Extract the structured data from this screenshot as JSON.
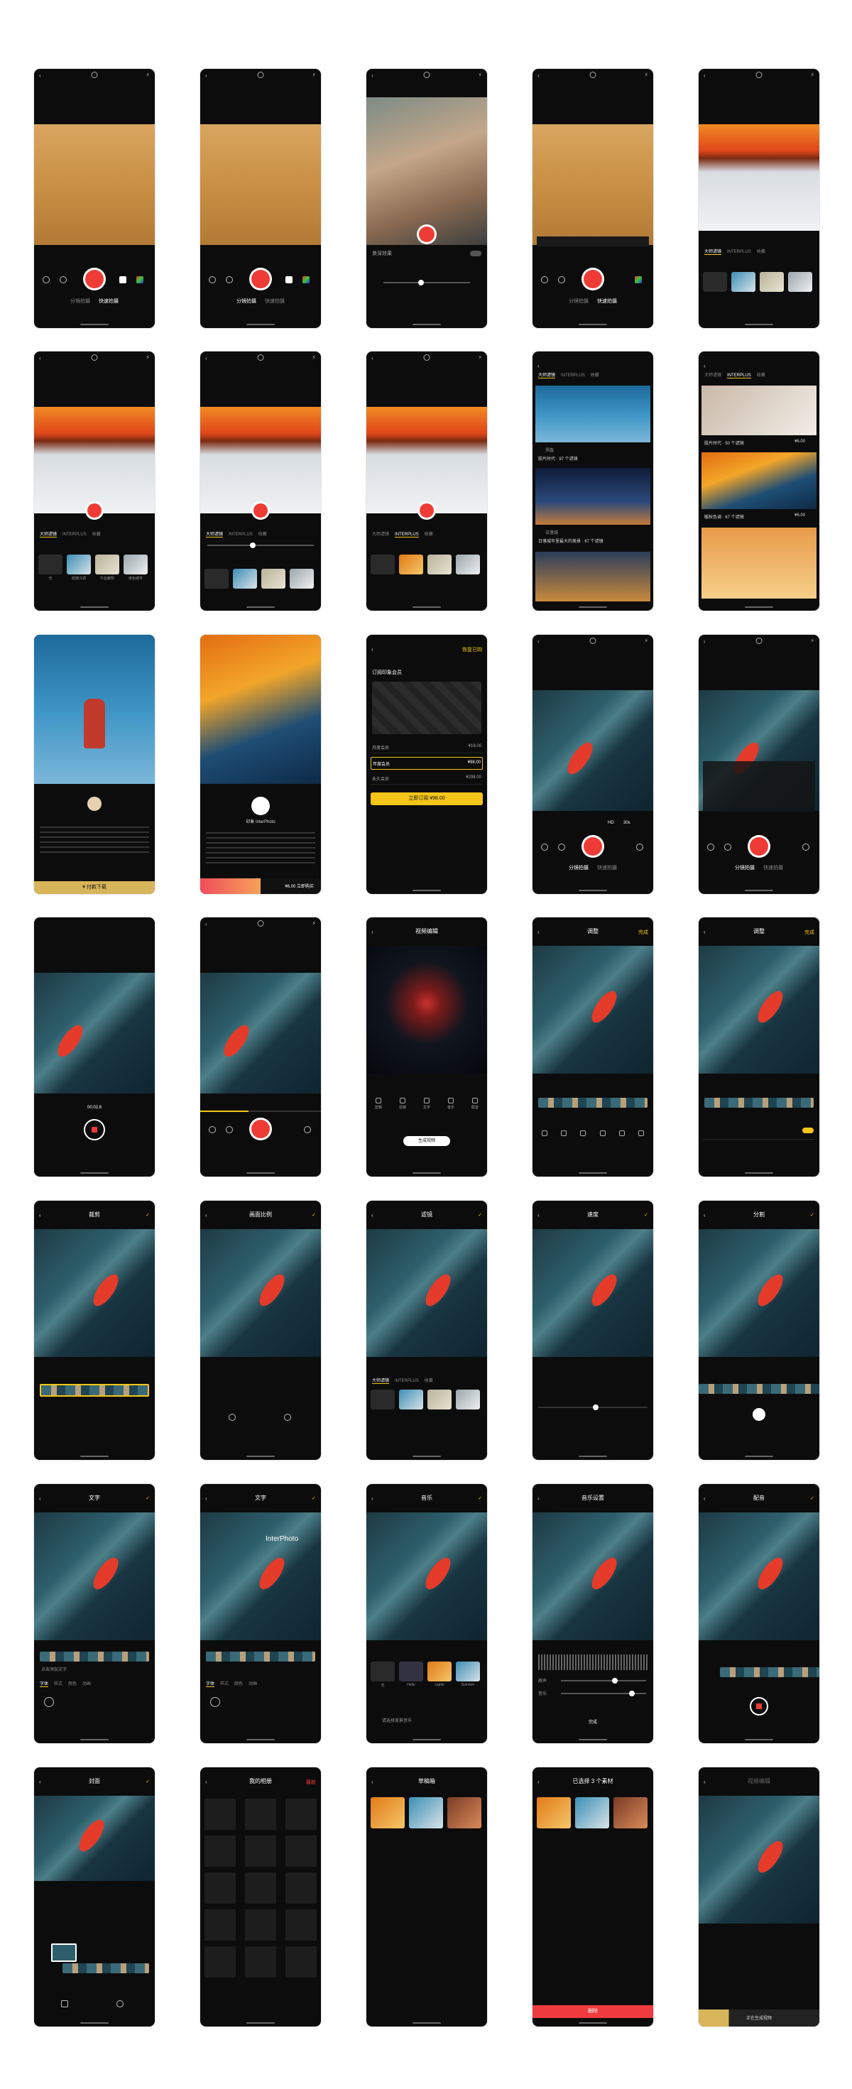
{
  "camera": {
    "mode_tabs": [
      "分镜拍摄",
      "快速拍摄"
    ],
    "blur_label": "景深效果",
    "sheet_speed": [
      "HD",
      "30s"
    ],
    "timer": "00:02.8"
  },
  "filters": {
    "tabs": [
      "大师滤镜",
      "INTERPLUS",
      "收藏"
    ],
    "labels": [
      "无",
      "经典冷调",
      "午后暖阳",
      "夜色城市"
    ]
  },
  "store": {
    "card1_title": "胶片时代 · 97 个滤镜",
    "card1_author": "郑鑫",
    "card2_title": "日落城市里最大的美景 · 67 个滤镜",
    "card2_author": "日落城",
    "card3_title": "胶片时代 · 50 个滤镜",
    "card3_price": "¥6.00",
    "card4_title": "暖秋色调 · 67 个滤镜",
    "card4_price": "¥6.00"
  },
  "detail": {
    "cta": "¥ 付款下载",
    "name2": "印象 InterPhoto",
    "price_bar": "¥6.00 立即购买"
  },
  "vip": {
    "title": "订阅印象会员",
    "restore": "恢复已购",
    "plans": [
      {
        "name": "月度会员",
        "price": "¥18.00"
      },
      {
        "name": "年度会员",
        "price": "¥98.00"
      },
      {
        "name": "永久会员",
        "price": "¥298.00"
      }
    ],
    "btn": "立即订阅 ¥98.00"
  },
  "editor": {
    "title": "视频编辑",
    "tools": [
      "剪辑",
      "滤镜",
      "文字",
      "音乐",
      "配音"
    ],
    "export": "生成视频",
    "adjust_title": "调整",
    "done": "完成",
    "speed_title": "速度",
    "split_title": "分割",
    "crop_title": "裁剪",
    "canvas_title": "画面比例",
    "filter_title": "滤镜",
    "text_title": "文字",
    "text_hint": "点击添加文字",
    "text_tabs": [
      "字体",
      "样式",
      "颜色",
      "动画"
    ],
    "watermark": "InterPhoto",
    "music_title": "音乐",
    "music_hint": "请选择背景音乐",
    "music_cats": [
      "无",
      "Hello",
      "Lights",
      "Summer"
    ],
    "volume_title": "音乐设置",
    "volume_rows": [
      "原声",
      "音乐"
    ],
    "cover_title": "封面",
    "voice_title": "配音"
  },
  "gallery": {
    "title": "我的相册",
    "tag": "最新",
    "drafts": "草稿箱",
    "import": "已选择 3 个素材",
    "delete": "删除",
    "saving": "正在生成视频"
  }
}
